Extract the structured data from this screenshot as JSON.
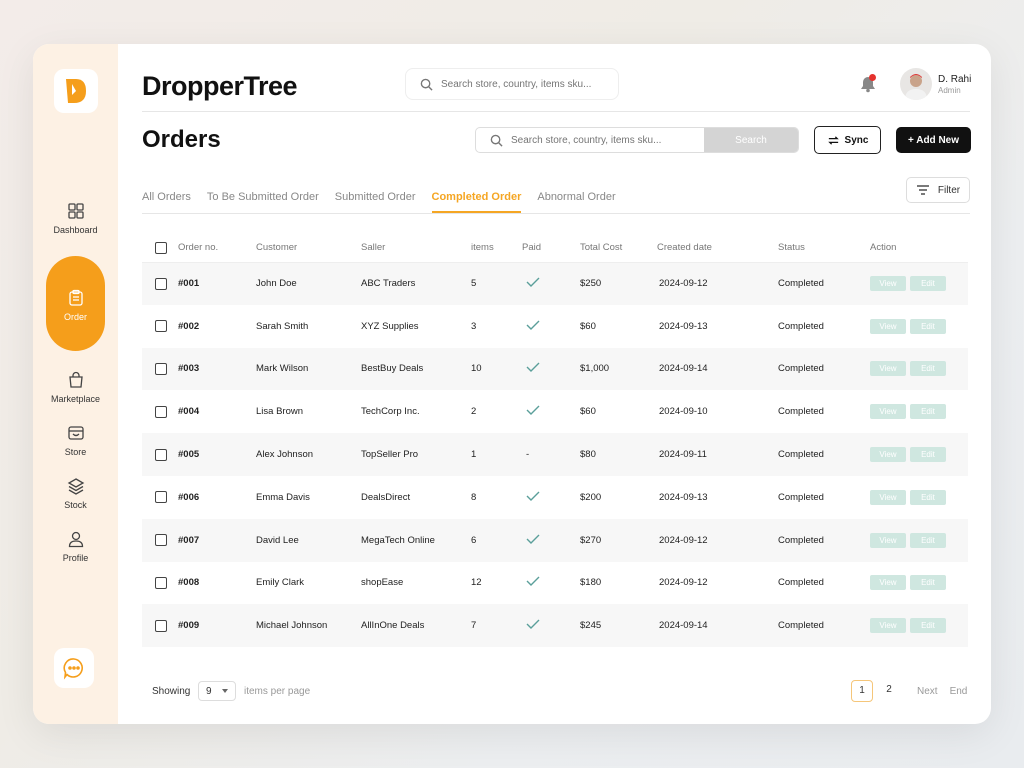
{
  "app": {
    "brand": "DropperTree",
    "accent_color": "#f59e1b",
    "top_search_placeholder": "Search store, country, items sku...",
    "user": {
      "name": "D. Rahi",
      "role": "Admin"
    }
  },
  "sidebar": {
    "items": [
      {
        "label": "Dashboard",
        "icon": "dashboard-grid-icon"
      },
      {
        "label": "Order",
        "icon": "clipboard-icon",
        "active": true
      },
      {
        "label": "Marketplace",
        "icon": "shopping-bag-icon"
      },
      {
        "label": "Store",
        "icon": "store-icon"
      },
      {
        "label": "Stock",
        "icon": "layers-icon"
      },
      {
        "label": "Profile",
        "icon": "user-icon"
      }
    ]
  },
  "page": {
    "title": "Orders",
    "search_placeholder": "Search store, country, items sku...",
    "search_button": "Search",
    "sync_button": "Sync",
    "add_button": "+ Add New",
    "filter_button": "Filter"
  },
  "tabs": [
    {
      "label": "All Orders"
    },
    {
      "label": "To Be Submitted Order"
    },
    {
      "label": "Submitted Order"
    },
    {
      "label": "Completed Order",
      "active": true
    },
    {
      "label": "Abnormal Order"
    }
  ],
  "table": {
    "headers": [
      "Order no.",
      "Customer",
      "Saller",
      "items",
      "Paid",
      "Total Cost",
      "Created date",
      "Status",
      "Action"
    ],
    "view_label": "View",
    "edit_label": "Edit",
    "rows": [
      {
        "order": "#001",
        "customer": "John Doe",
        "seller": "ABC Traders",
        "items": "5",
        "paid": true,
        "total": "$250",
        "date": "2024-09-12",
        "status": "Completed"
      },
      {
        "order": "#002",
        "customer": "Sarah Smith",
        "seller": "XYZ Supplies",
        "items": "3",
        "paid": true,
        "total": "$60",
        "date": "2024-09-13",
        "status": "Completed"
      },
      {
        "order": "#003",
        "customer": "Mark Wilson",
        "seller": "BestBuy Deals",
        "items": "10",
        "paid": true,
        "total": "$1,000",
        "date": "2024-09-14",
        "status": "Completed"
      },
      {
        "order": "#004",
        "customer": "Lisa Brown",
        "seller": "TechCorp Inc.",
        "items": "2",
        "paid": true,
        "total": "$60",
        "date": "2024-09-10",
        "status": "Completed"
      },
      {
        "order": "#005",
        "customer": "Alex Johnson",
        "seller": "TopSeller Pro",
        "items": "1",
        "paid": false,
        "paid_text": "-",
        "total": "$80",
        "date": "2024-09-11",
        "status": "Completed"
      },
      {
        "order": "#006",
        "customer": "Emma Davis",
        "seller": "DealsDirect",
        "items": "8",
        "paid": true,
        "total": "$200",
        "date": "2024-09-13",
        "status": "Completed"
      },
      {
        "order": "#007",
        "customer": "David Lee",
        "seller": "MegaTech Online",
        "items": "6",
        "paid": true,
        "total": "$270",
        "date": "2024-09-12",
        "status": "Completed"
      },
      {
        "order": "#008",
        "customer": "Emily Clark",
        "seller": "shopEase",
        "items": "12",
        "paid": true,
        "total": "$180",
        "date": "2024-09-12",
        "status": "Completed"
      },
      {
        "order": "#009",
        "customer": "Michael Johnson",
        "seller": "AllInOne Deals",
        "items": "7",
        "paid": true,
        "total": "$245",
        "date": "2024-09-14",
        "status": "Completed"
      }
    ]
  },
  "footer": {
    "showing_label": "Showing",
    "per_page_value": "9",
    "per_page_label": "items per page",
    "pages": [
      "1",
      "2"
    ],
    "current_page": "1",
    "next_label": "Next",
    "end_label": "End"
  }
}
